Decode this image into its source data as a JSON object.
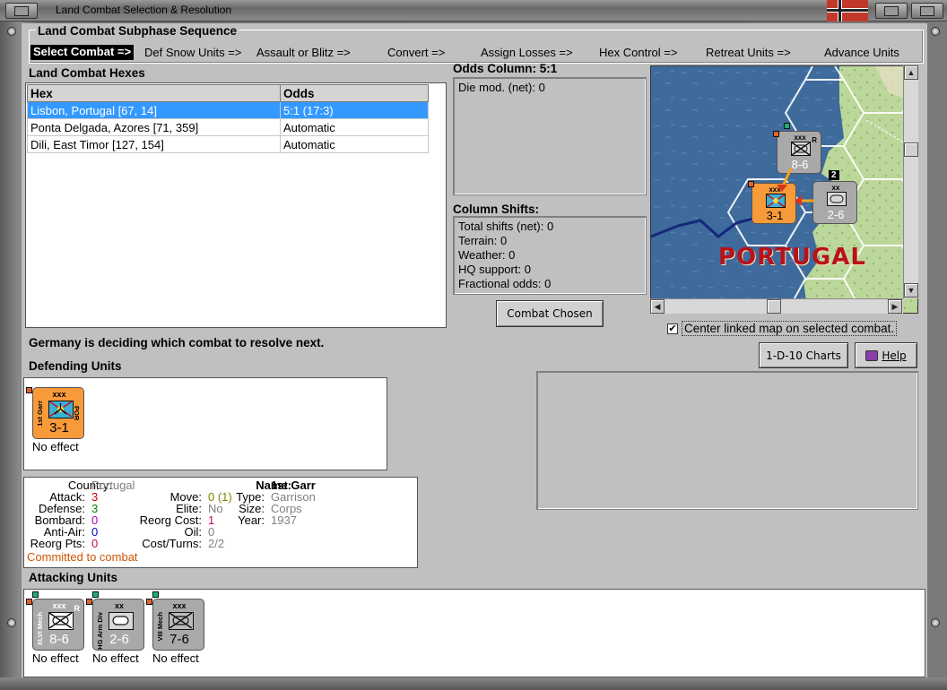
{
  "window": {
    "title": "Land Combat Selection & Resolution"
  },
  "subphase": {
    "title": "Land Combat Subphase Sequence",
    "steps": [
      "Select Combat =>",
      "Def Snow Units =>",
      "Assault or Blitz =>",
      "Convert =>",
      "Assign Losses =>",
      "Hex Control =>",
      "Retreat Units =>",
      "Advance Units"
    ]
  },
  "hexes": {
    "title": "Land Combat Hexes",
    "columns": [
      "Hex",
      "Odds"
    ],
    "rows": [
      {
        "hex": "Lisbon, Portugal [67, 14]",
        "odds": "5:1 (17:3)"
      },
      {
        "hex": "Ponta Delgada, Azores [71, 359]",
        "odds": "Automatic"
      },
      {
        "hex": "Dili, East Timor [127, 154]",
        "odds": "Automatic"
      }
    ]
  },
  "odds": {
    "title": "Odds Column: 5:1",
    "die_mod": "Die mod. (net): 0"
  },
  "shifts": {
    "title": "Column Shifts:",
    "lines": [
      "Total shifts (net): 0",
      "Terrain: 0",
      "Weather: 0",
      "HQ support: 0",
      "Fractional odds: 0"
    ]
  },
  "buttons": {
    "combat_chosen": "Combat Chosen",
    "charts": "1-D-10 Charts",
    "help": "Help"
  },
  "map": {
    "country_label": "PORTUGAL",
    "center_linked_label": "Center linked map on selected combat.",
    "center_linked_checked": true,
    "unit_a": {
      "size": "xxx",
      "strength": "8-6",
      "side": "XLVI Mech",
      "flag": "R"
    },
    "unit_b": {
      "size": "xxx",
      "strength": "3-1",
      "side": "1st Garr"
    },
    "unit_c": {
      "size": "xx",
      "strength": "2-6",
      "side": "HG Arm Div",
      "badge": "2"
    }
  },
  "status": "Germany is deciding which combat to resolve next.",
  "defending": {
    "title": "Defending Units",
    "units": [
      {
        "size": "xxx",
        "strength": "3-1",
        "side": "1st Garr",
        "nation": "POR",
        "effect": "No effect",
        "color": "#f79a3a"
      }
    ]
  },
  "unit_info": {
    "country_label": "Country:",
    "country": "Portugal",
    "attack_label": "Attack:",
    "attack": "3",
    "defense_label": "Defense:",
    "defense": "3",
    "bombard_label": "Bombard:",
    "bombard": "0",
    "antiair_label": "Anti-Air:",
    "antiair": "0",
    "reorg_pts_label": "Reorg Pts:",
    "reorg_pts": "0",
    "move_label": "Move:",
    "move": "0 (1)",
    "elite_label": "Elite:",
    "elite": "No",
    "reorg_cost_label": "Reorg Cost:",
    "reorg_cost": "1",
    "oil_label": "Oil:",
    "oil": "0",
    "cost_turns_label": "Cost/Turns:",
    "cost_turns": "2/2",
    "name_label": "Name:",
    "name": "1st Garr",
    "type_label": "Type:",
    "type": "Garrison",
    "size_label": "Size:",
    "size": "Corps",
    "year_label": "Year:",
    "year": "1937",
    "committed": "Committed to combat"
  },
  "attacking": {
    "title": "Attacking Units",
    "units": [
      {
        "size": "xxx",
        "strength": "8-6",
        "side": "XLVI Mech",
        "flag": "R",
        "effect": "No effect"
      },
      {
        "size": "xx",
        "strength": "2-6",
        "side": "HG Arm Div",
        "flag": "",
        "effect": "No effect"
      },
      {
        "size": "xxx",
        "strength": "7-6",
        "side": "VIII Mech",
        "flag": "",
        "effect": "No effect"
      }
    ]
  },
  "colors": {
    "selected_row": "#3399ff",
    "committed": "#cc5500",
    "attack": "#cc0000",
    "defense": "#008800",
    "bombard": "#aa00aa",
    "antiair": "#0000cc",
    "reorg": "#cc0066",
    "muted": "#808080"
  }
}
